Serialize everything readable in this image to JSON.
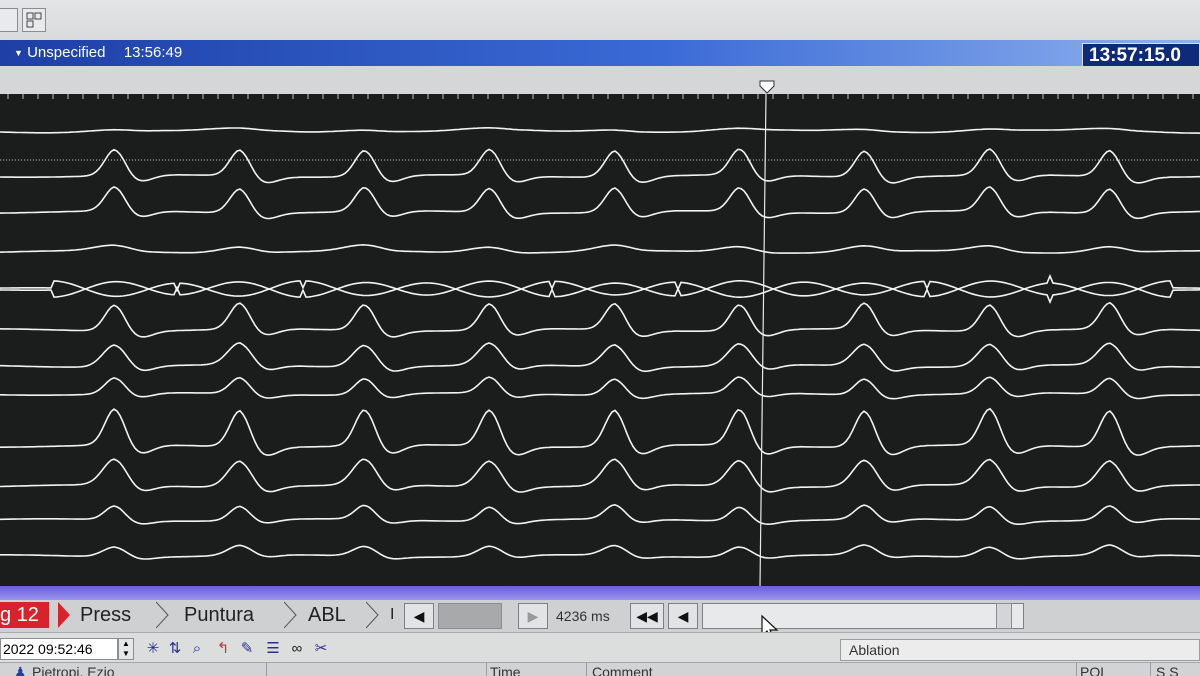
{
  "window": {
    "title": "Unspecified",
    "start_time": "13:56:49",
    "clock": "13:57:15.0"
  },
  "toolbar": {
    "icons": [
      "window-icon",
      "layout-icon"
    ]
  },
  "traces": {
    "channel_count": 12,
    "background": "#1a1d1c",
    "trace_color": "#f2f2f2",
    "marker_time_ms": 4236
  },
  "tabs": [
    {
      "label": "g 12",
      "active": true
    },
    {
      "label": "Press",
      "active": false
    },
    {
      "label": "Puntura",
      "active": false
    },
    {
      "label": "ABL",
      "active": false
    },
    {
      "label": "I",
      "active": false
    }
  ],
  "playback": {
    "sweep": "4236 ms",
    "prev_label": "◀",
    "next_label": "▶",
    "rewind_label": "◀◀",
    "step_back_label": "◀"
  },
  "status": {
    "date_time": "2022  09:52:46",
    "mode": "Ablation"
  },
  "table_header": {
    "patient": "Pietropi, Ezio",
    "col_time": "Time",
    "col_comment": "Comment",
    "col_pol": "POL",
    "col_ss": "S S"
  },
  "colors": {
    "title_bar": "#1d3fa6",
    "active_tab": "#d8232c",
    "purple_strip": "#6a5ed8"
  }
}
